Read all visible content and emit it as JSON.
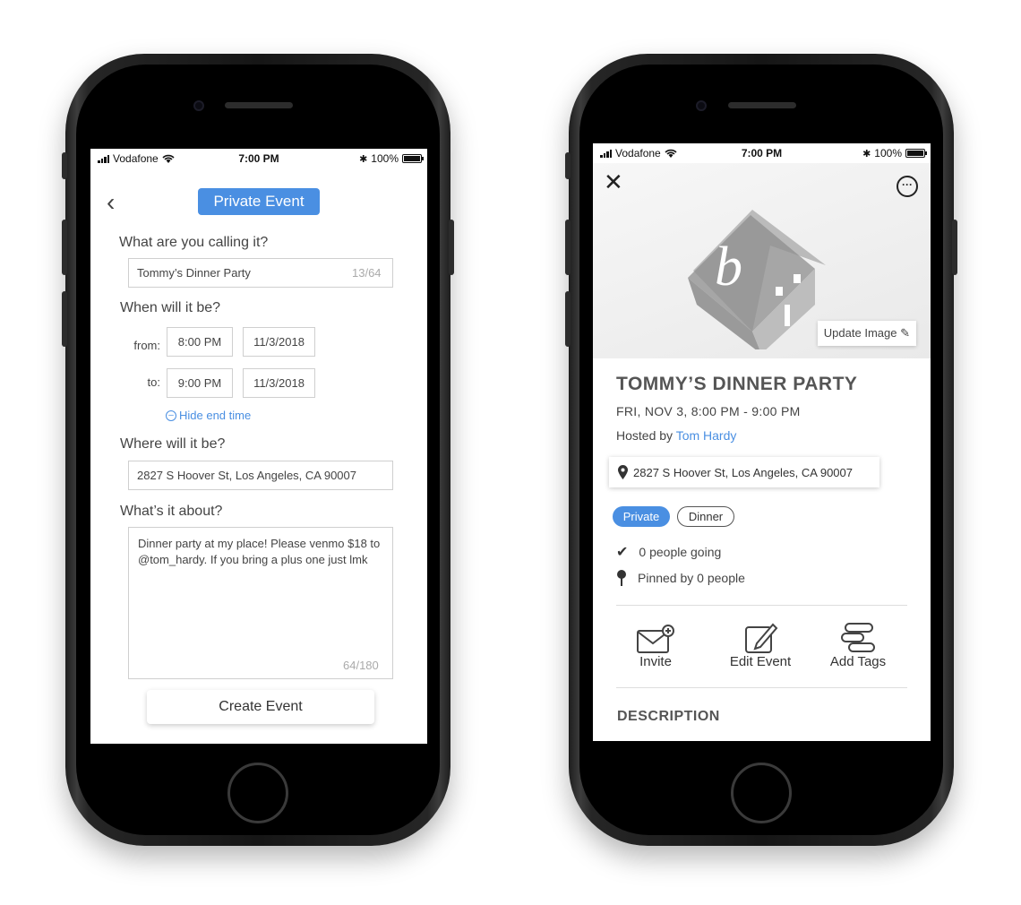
{
  "status_bar": {
    "carrier": "Vodafone",
    "time": "7:00 PM",
    "battery": "100%"
  },
  "create_screen": {
    "header_title": "Private Event",
    "name_question": "What are you calling it?",
    "name_value": "Tommy’s Dinner Party",
    "name_counter": "13/64",
    "when_question": "When will it be?",
    "from_label": "from:",
    "from_time": "8:00 PM",
    "from_date": "11/3/2018",
    "to_label": "to:",
    "to_time": "9:00 PM",
    "to_date": "11/3/2018",
    "hide_end_time": "Hide end time",
    "where_question": "Where will it be?",
    "where_value": "2827 S Hoover St, Los Angeles, CA 90007",
    "about_question": "What’s it about?",
    "about_value": "Dinner party at my place! Please venmo $18 to @tom_hardy. If you bring a plus one just lmk",
    "about_counter": "64/180",
    "create_button": "Create Event"
  },
  "detail_screen": {
    "update_image": "Update Image",
    "event_title": "TOMMY’S DINNER PARTY",
    "event_datetime": "FRI, NOV 3, 8:00 PM - 9:00 PM",
    "hosted_by": "Hosted by",
    "host_name": "Tom Hardy",
    "address": "2827 S Hoover St, Los Angeles, CA 90007",
    "tags": [
      "Private",
      "Dinner"
    ],
    "going": "0 people going",
    "pinned": "Pinned by 0 people",
    "actions": [
      "Invite",
      "Edit Event",
      "Add Tags"
    ],
    "description_heading": "DESCRIPTION"
  },
  "colors": {
    "accent": "#4a8fe2"
  }
}
